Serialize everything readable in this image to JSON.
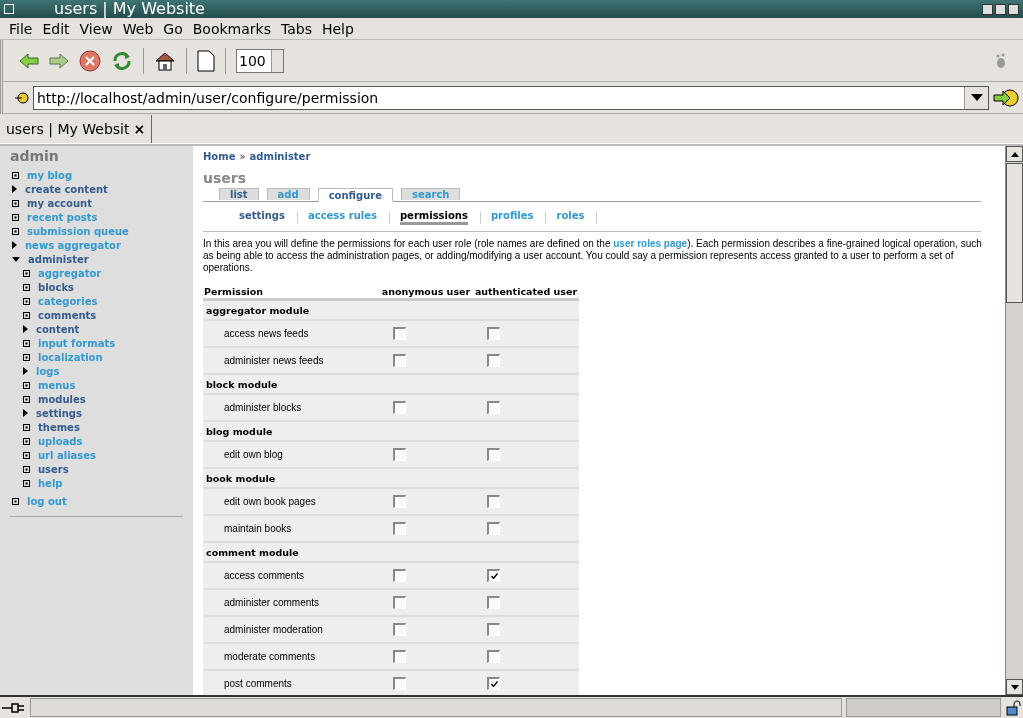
{
  "window": {
    "title": "users | My Website"
  },
  "menu": [
    "File",
    "Edit",
    "View",
    "Web",
    "Go",
    "Bookmarks",
    "Tabs",
    "Help"
  ],
  "zoom": {
    "value": "100"
  },
  "address": {
    "value": "http://localhost/admin/user/configure/permission"
  },
  "browser_tabs": [
    {
      "label": "users | My Websit",
      "close": "×",
      "selected": true
    }
  ],
  "sidebar": {
    "title": "admin",
    "items": [
      {
        "label": "my blog",
        "kind": "leaf",
        "visited": false
      },
      {
        "label": "create content",
        "kind": "collapsed",
        "visited": true
      },
      {
        "label": "my account",
        "kind": "leaf",
        "visited": true
      },
      {
        "label": "recent posts",
        "kind": "leaf",
        "visited": false
      },
      {
        "label": "submission queue",
        "kind": "leaf",
        "visited": false
      },
      {
        "label": "news aggregator",
        "kind": "collapsed",
        "visited": false
      },
      {
        "label": "administer",
        "kind": "expanded",
        "visited": true,
        "children": [
          {
            "label": "aggregator",
            "kind": "leaf",
            "visited": false
          },
          {
            "label": "blocks",
            "kind": "leaf",
            "visited": true
          },
          {
            "label": "categories",
            "kind": "leaf",
            "visited": false
          },
          {
            "label": "comments",
            "kind": "leaf",
            "visited": true
          },
          {
            "label": "content",
            "kind": "collapsed",
            "visited": true
          },
          {
            "label": "input formats",
            "kind": "leaf",
            "visited": false
          },
          {
            "label": "localization",
            "kind": "leaf",
            "visited": false
          },
          {
            "label": "logs",
            "kind": "collapsed",
            "visited": false
          },
          {
            "label": "menus",
            "kind": "leaf",
            "visited": false
          },
          {
            "label": "modules",
            "kind": "leaf",
            "visited": true
          },
          {
            "label": "settings",
            "kind": "collapsed",
            "visited": true
          },
          {
            "label": "themes",
            "kind": "leaf",
            "visited": true
          },
          {
            "label": "uploads",
            "kind": "leaf",
            "visited": false
          },
          {
            "label": "url aliases",
            "kind": "leaf",
            "visited": false
          },
          {
            "label": "users",
            "kind": "leaf",
            "visited": true
          },
          {
            "label": "help",
            "kind": "leaf",
            "visited": false
          }
        ]
      },
      {
        "label": "log out",
        "kind": "leaf",
        "visited": false
      }
    ]
  },
  "breadcrumb": [
    "Home",
    "administer"
  ],
  "breadcrumb_separator": "»",
  "page_title": "users",
  "tabs": [
    {
      "label": "list",
      "selected": false,
      "visited": true
    },
    {
      "label": "add",
      "selected": false,
      "visited": false
    },
    {
      "label": "configure",
      "selected": true,
      "visited": true
    },
    {
      "label": "search",
      "selected": false,
      "visited": false
    }
  ],
  "subtabs": [
    {
      "label": "settings",
      "selected": false,
      "visited": true
    },
    {
      "label": "access rules",
      "selected": false,
      "visited": false
    },
    {
      "label": "permissions",
      "selected": true,
      "visited": true
    },
    {
      "label": "profiles",
      "selected": false,
      "visited": false
    },
    {
      "label": "roles",
      "selected": false,
      "visited": false
    }
  ],
  "description": {
    "before": "In this area you will define the permissions for each user role (role names are defined on the ",
    "link": "user roles page",
    "after": "). Each permission describes a fine-grained logical operation, such as being able to access the administration pages, or adding/modifying a user account. You could say a permission represents access granted to a user to perform a set of operations."
  },
  "table": {
    "columns": [
      "Permission",
      "anonymous user",
      "authenticated user"
    ],
    "rows": [
      {
        "kind": "module",
        "label": "aggregator module"
      },
      {
        "kind": "permission",
        "label": "access news feeds",
        "anonymous": false,
        "authenticated": false
      },
      {
        "kind": "permission",
        "label": "administer news feeds",
        "anonymous": false,
        "authenticated": false
      },
      {
        "kind": "module",
        "label": "block module"
      },
      {
        "kind": "permission",
        "label": "administer blocks",
        "anonymous": false,
        "authenticated": false
      },
      {
        "kind": "module",
        "label": "blog module"
      },
      {
        "kind": "permission",
        "label": "edit own blog",
        "anonymous": false,
        "authenticated": false
      },
      {
        "kind": "module",
        "label": "book module"
      },
      {
        "kind": "permission",
        "label": "edit own book pages",
        "anonymous": false,
        "authenticated": false
      },
      {
        "kind": "permission",
        "label": "maintain books",
        "anonymous": false,
        "authenticated": false
      },
      {
        "kind": "module",
        "label": "comment module"
      },
      {
        "kind": "permission",
        "label": "access comments",
        "anonymous": false,
        "authenticated": true
      },
      {
        "kind": "permission",
        "label": "administer comments",
        "anonymous": false,
        "authenticated": false
      },
      {
        "kind": "permission",
        "label": "administer moderation",
        "anonymous": false,
        "authenticated": false
      },
      {
        "kind": "permission",
        "label": "moderate comments",
        "anonymous": false,
        "authenticated": false
      },
      {
        "kind": "permission",
        "label": "post comments",
        "anonymous": false,
        "authenticated": true
      }
    ]
  }
}
